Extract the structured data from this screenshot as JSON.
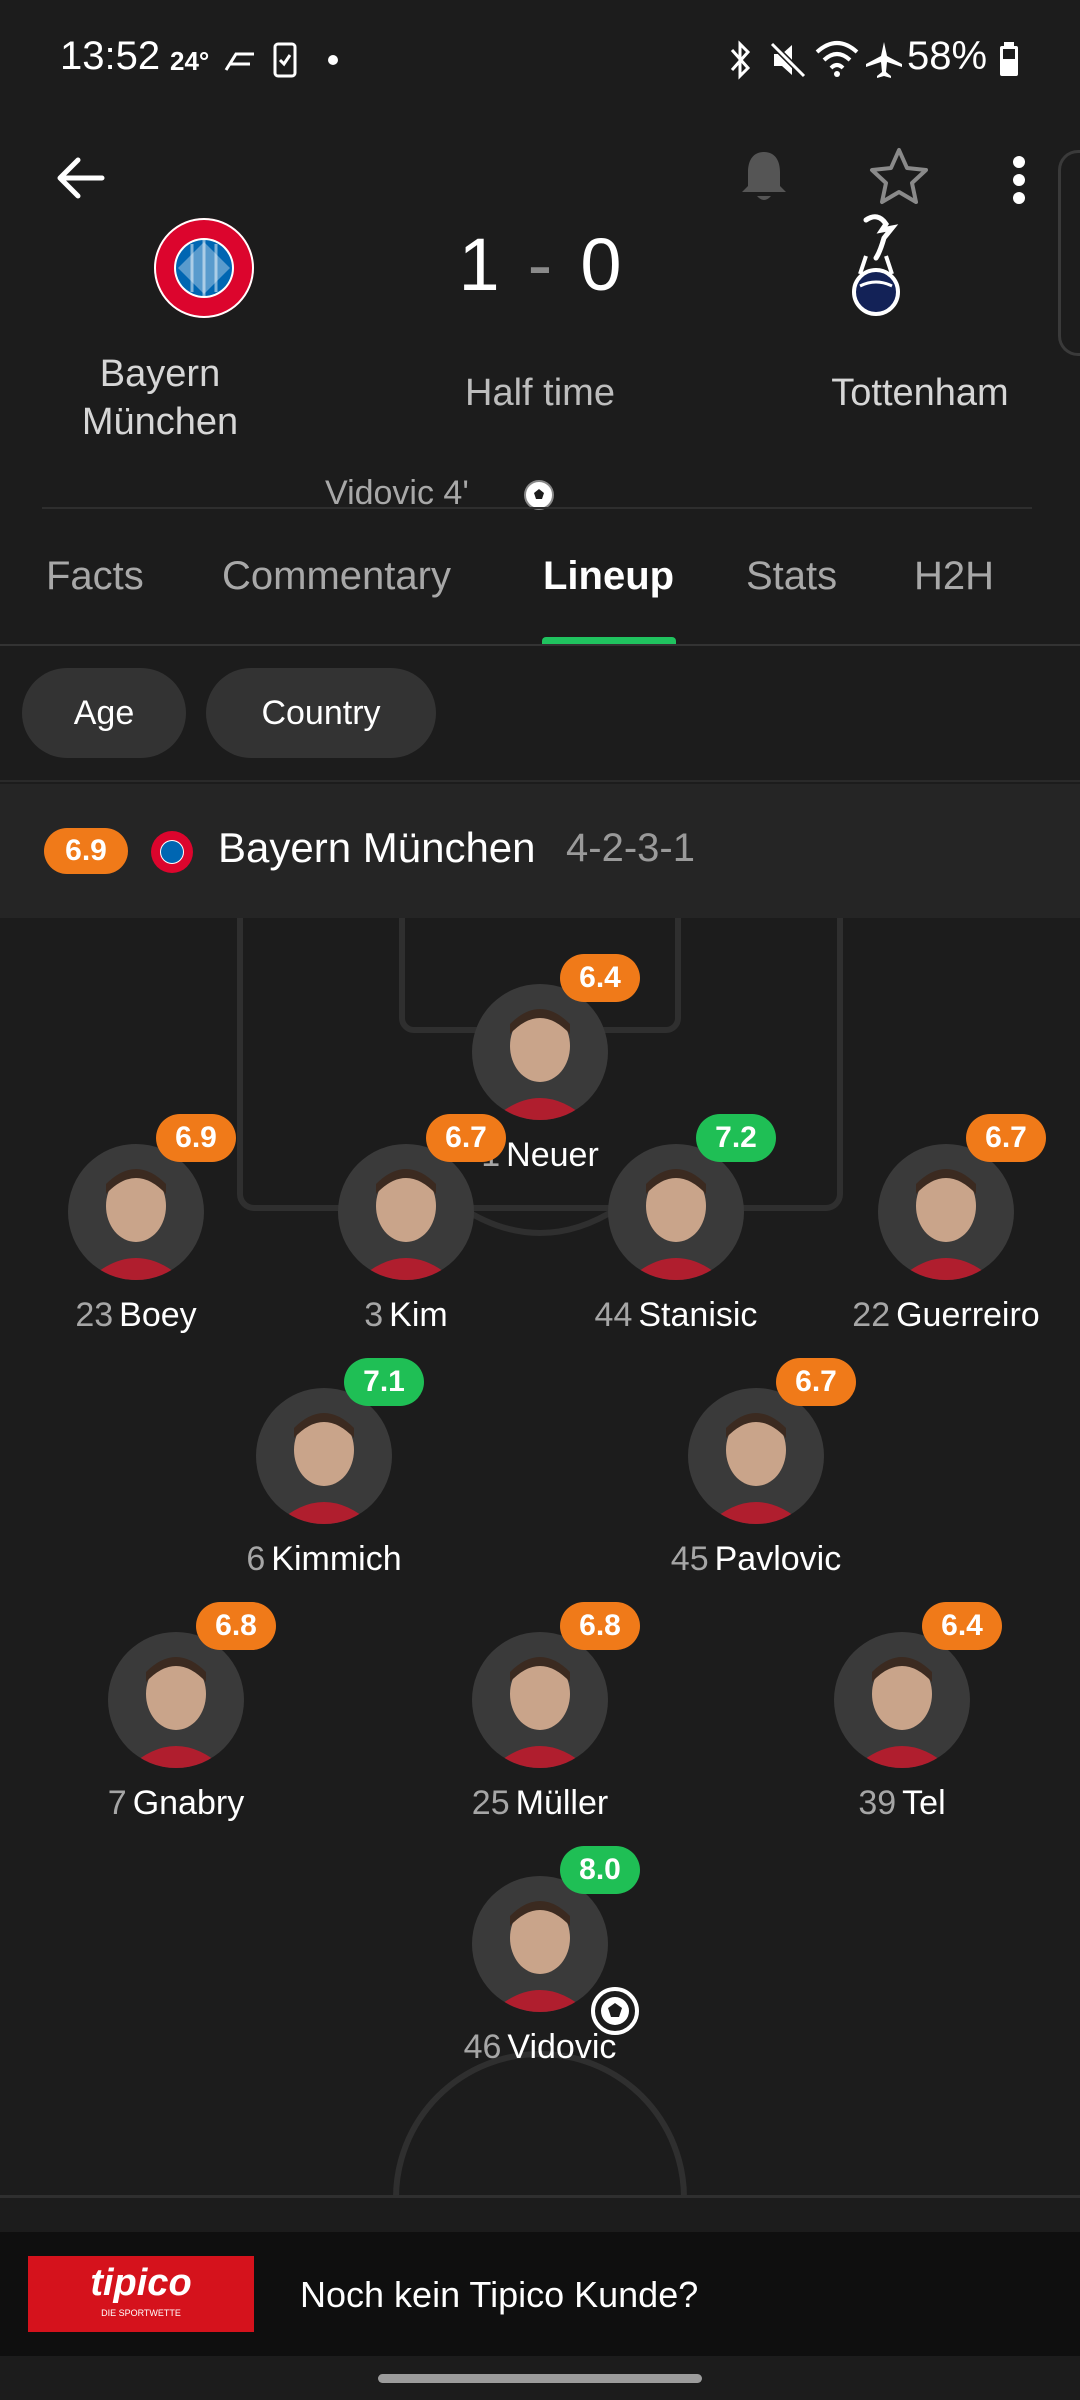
{
  "status_bar": {
    "time": "13:52",
    "temperature": "24°",
    "battery": "58%"
  },
  "match": {
    "home_team": "Bayern München",
    "away_team": "Tottenham",
    "home_score": "1",
    "away_score": "0",
    "separator": "-",
    "status": "Half time",
    "scorer": "Vidovic 4'"
  },
  "tabs": [
    {
      "label": "Facts"
    },
    {
      "label": "Commentary"
    },
    {
      "label": "Lineup"
    },
    {
      "label": "Stats"
    },
    {
      "label": "H2H"
    }
  ],
  "active_tab": "Lineup",
  "filters": [
    {
      "label": "Age"
    },
    {
      "label": "Country"
    }
  ],
  "team_bar": {
    "rating": "6.9",
    "team_name": "Bayern München",
    "formation": "4-2-3-1"
  },
  "lineup": [
    {
      "number": "1",
      "name": "Neuer",
      "rating": "6.4",
      "rating_color": "orange"
    },
    {
      "number": "23",
      "name": "Boey",
      "rating": "6.9",
      "rating_color": "orange"
    },
    {
      "number": "3",
      "name": "Kim",
      "rating": "6.7",
      "rating_color": "orange"
    },
    {
      "number": "44",
      "name": "Stanisic",
      "rating": "7.2",
      "rating_color": "green"
    },
    {
      "number": "22",
      "name": "Guerreiro",
      "rating": "6.7",
      "rating_color": "orange"
    },
    {
      "number": "6",
      "name": "Kimmich",
      "rating": "7.1",
      "rating_color": "green"
    },
    {
      "number": "45",
      "name": "Pavlovic",
      "rating": "6.7",
      "rating_color": "orange"
    },
    {
      "number": "7",
      "name": "Gnabry",
      "rating": "6.8",
      "rating_color": "orange"
    },
    {
      "number": "25",
      "name": "Müller",
      "rating": "6.8",
      "rating_color": "orange"
    },
    {
      "number": "39",
      "name": "Tel",
      "rating": "6.4",
      "rating_color": "orange"
    },
    {
      "number": "46",
      "name": "Vidovic",
      "rating": "8.0",
      "rating_color": "green",
      "scored": true
    }
  ],
  "ad": {
    "brand": "tipico",
    "brand_sub": "DIE SPORTWETTE",
    "text": "Noch kein Tipico Kunde?"
  },
  "colors": {
    "accent_green": "#20c35f",
    "rating_orange": "#f07a19",
    "rating_green": "#1fbf55",
    "ad_red": "#d5121c"
  }
}
